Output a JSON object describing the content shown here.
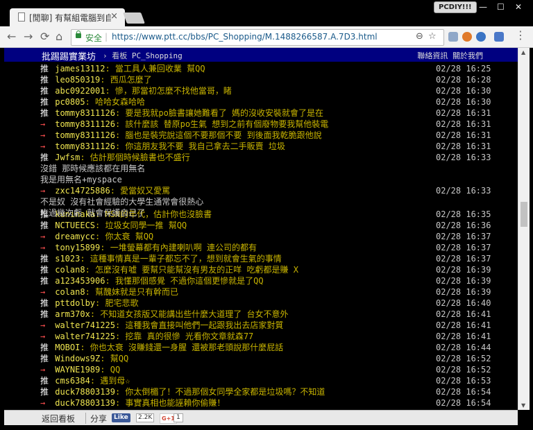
{
  "browser": {
    "tab_title": "[閒聊] 有幫組電腦到自己",
    "tab_close": "×",
    "badge": "PCDIY!!!",
    "win_min": "—",
    "win_max": "☐",
    "win_close": "✕",
    "secure_label": "安全",
    "url": "https://www.ptt.cc/bbs/PC_Shopping/M.1488266587.A.7D3.html"
  },
  "ptt": {
    "site_name": "批踢踢實業坊",
    "breadcrumb_sep": "›",
    "board_label": "看板",
    "board_name": "PC_Shopping",
    "right_links": "聯絡資訊 關於我們"
  },
  "comments": [
    {
      "tag": "推",
      "user": "james13112",
      "text": ": 當工具人兼回收業  幫QQ",
      "time": "02/28 16:25"
    },
    {
      "tag": "推",
      "user": "leo850319",
      "text": ": 西瓜怎麼了",
      "time": "02/28 16:28"
    },
    {
      "tag": "推",
      "user": "abc0922001",
      "text": ": 慘，那當初怎麼不找他當哥，睹",
      "time": "02/28 16:30"
    },
    {
      "tag": "推",
      "user": "pc0805",
      "text": ": 哈哈女森哈哈",
      "time": "02/28 16:30"
    },
    {
      "tag": "推",
      "user": "tommy8311126",
      "text": ": 要是我就po臉書讓她難看了 媽的沒收安裝就會了是在",
      "time": "02/28 16:31"
    },
    {
      "tag": "→",
      "user": "tommy8311126",
      "text": ": 該什麼該 替原po生氣 想到之前有個廢物要我幫他裝電",
      "time": "02/28 16:31"
    },
    {
      "tag": "→",
      "user": "tommy8311126",
      "text": ": 腦也是裝完說這個不要那個不要 到後面我乾脆跟他說",
      "time": "02/28 16:31"
    },
    {
      "tag": "→",
      "user": "tommy8311126",
      "text": ": 你這朋友我不要 我自己拿去二手販賣 垃圾",
      "time": "02/28 16:31"
    },
    {
      "tag": "推",
      "user": "Jwfsm",
      "text": ": 估計那個時候臉書也不盛行",
      "time": "02/28 16:33"
    },
    {
      "tag": "→",
      "user": "zxc14725886",
      "text": ": 愛當奴又愛罵",
      "time": "02/28 16:33"
    },
    {
      "tag": "推",
      "user": "kuninaka",
      "text": ": MSN的年代，估計你也沒臉書",
      "time": "02/28 16:35"
    },
    {
      "tag": "推",
      "user": "NCTUEECS",
      "text": ": 垃圾女同學一推 幫QQ",
      "time": "02/28 16:36"
    },
    {
      "tag": "→",
      "user": "dreamycc",
      "text": ": 你太衰 幫QQ",
      "time": "02/28 16:37"
    },
    {
      "tag": "→",
      "user": "tony15899",
      "text": ": 一堆螢幕都有內建喇叭啊  連公司的都有",
      "time": "02/28 16:37"
    },
    {
      "tag": "推",
      "user": "s1023",
      "text": ": 這種事情真是一輩子都忘不了，想到就會生氣的事情",
      "time": "02/28 16:37"
    },
    {
      "tag": "推",
      "user": "colan8",
      "text": ": 怎麼沒有嘘 要幫只能幫沒有男友的正咩 吃虧都是賺 X",
      "time": "02/28 16:39"
    },
    {
      "tag": "推",
      "user": "a123453906",
      "text": ": 我懂那個感覺 不過你這個更慘就是了QQ",
      "time": "02/28 16:39"
    },
    {
      "tag": "→",
      "user": "colan8",
      "text": ": 幫醜妹就是只有幹而已",
      "time": "02/28 16:39"
    },
    {
      "tag": "推",
      "user": "pttdolby",
      "text": ": 肥宅悲歌",
      "time": "02/28 16:40"
    },
    {
      "tag": "推",
      "user": "arm370x",
      "text": ": 不知道女孩版又能講出些什麼大道理了  台女不意外",
      "time": "02/28 16:41"
    },
    {
      "tag": "→",
      "user": "walter741225",
      "text": ": 這種我會直接叫他們一起跟我出去店家對質",
      "time": "02/28 16:41"
    },
    {
      "tag": "→",
      "user": "walter741225",
      "text": ": 挖靠 真的很慘 光看你文章就森77",
      "time": "02/28 16:41"
    },
    {
      "tag": "推",
      "user": "MOBOI",
      "text": ": 你也太衰 沒賺錢還一身腥 還被那老頭說那什麼屁話",
      "time": "02/28 16:44"
    },
    {
      "tag": "推",
      "user": "Windows9Z",
      "text": ": 幫QQ",
      "time": "02/28 16:52"
    },
    {
      "tag": "→",
      "user": "WAYNE1989",
      "text": ": QQ",
      "time": "02/28 16:52"
    },
    {
      "tag": "推",
      "user": "cms6384",
      "text": ": 遇到母☆",
      "time": "02/28 16:53"
    },
    {
      "tag": "推",
      "user": "duck78803139",
      "text": ": 你太倒楣了！不過那個女同學全家都是垃圾嗎？不知道",
      "time": "02/28 16:54"
    },
    {
      "tag": "→",
      "user": "duck78803139",
      "text": ": 事實真相也能誣賴你偷賺！",
      "time": "02/28 16:54"
    }
  ],
  "plain_lines": [
    "沒錯 那時候應該都在用無名",
    "我是用無名+myspace",
    "不是奴 沒有社會經驗的大學生通常會很熱心",
    "吃過幾次虧 就會保護自己了"
  ],
  "footer": {
    "back": "返回看板",
    "share": "分享",
    "fb_like": "Like",
    "fb_count": "2.2K",
    "gplus": "G+1",
    "gplus_count": "1"
  }
}
